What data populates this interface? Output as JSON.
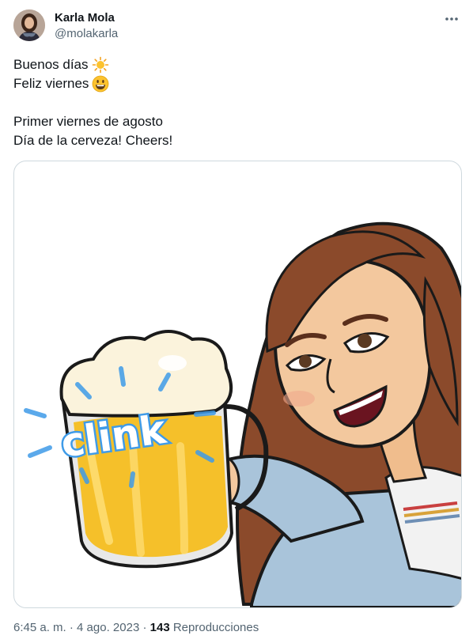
{
  "tweet": {
    "author": {
      "display_name": "Karla Mola",
      "handle": "@molakarla",
      "avatar_icon": "profile-photo"
    },
    "more_icon": "more-horizontal-icon",
    "text_lines": [
      {
        "text": "Buenos días",
        "emoji": "sun-icon"
      },
      {
        "text": "Feliz viernes",
        "emoji": "smiling-face-icon"
      },
      {
        "text": "Primer viernes de agosto"
      },
      {
        "text": "Día de la cerveza! Cheers!"
      }
    ],
    "media": {
      "description_icon": "bitmoji-beer-cheers-illustration",
      "sticker_text": "clink"
    },
    "meta": {
      "time": "6:45 a. m.",
      "separator": "·",
      "date": "4 ago. 2023",
      "views_count": "143",
      "views_label": "Reproducciones"
    }
  },
  "colors": {
    "text": "#0f1419",
    "secondary": "#536471",
    "border": "#cfd9de",
    "hair": "#8b4a2b",
    "skin": "#f3c89e",
    "beer": "#f5c02a",
    "foam": "#fbf3dc",
    "denim": "#a9c4da",
    "clink_blue": "#3f9be8"
  }
}
